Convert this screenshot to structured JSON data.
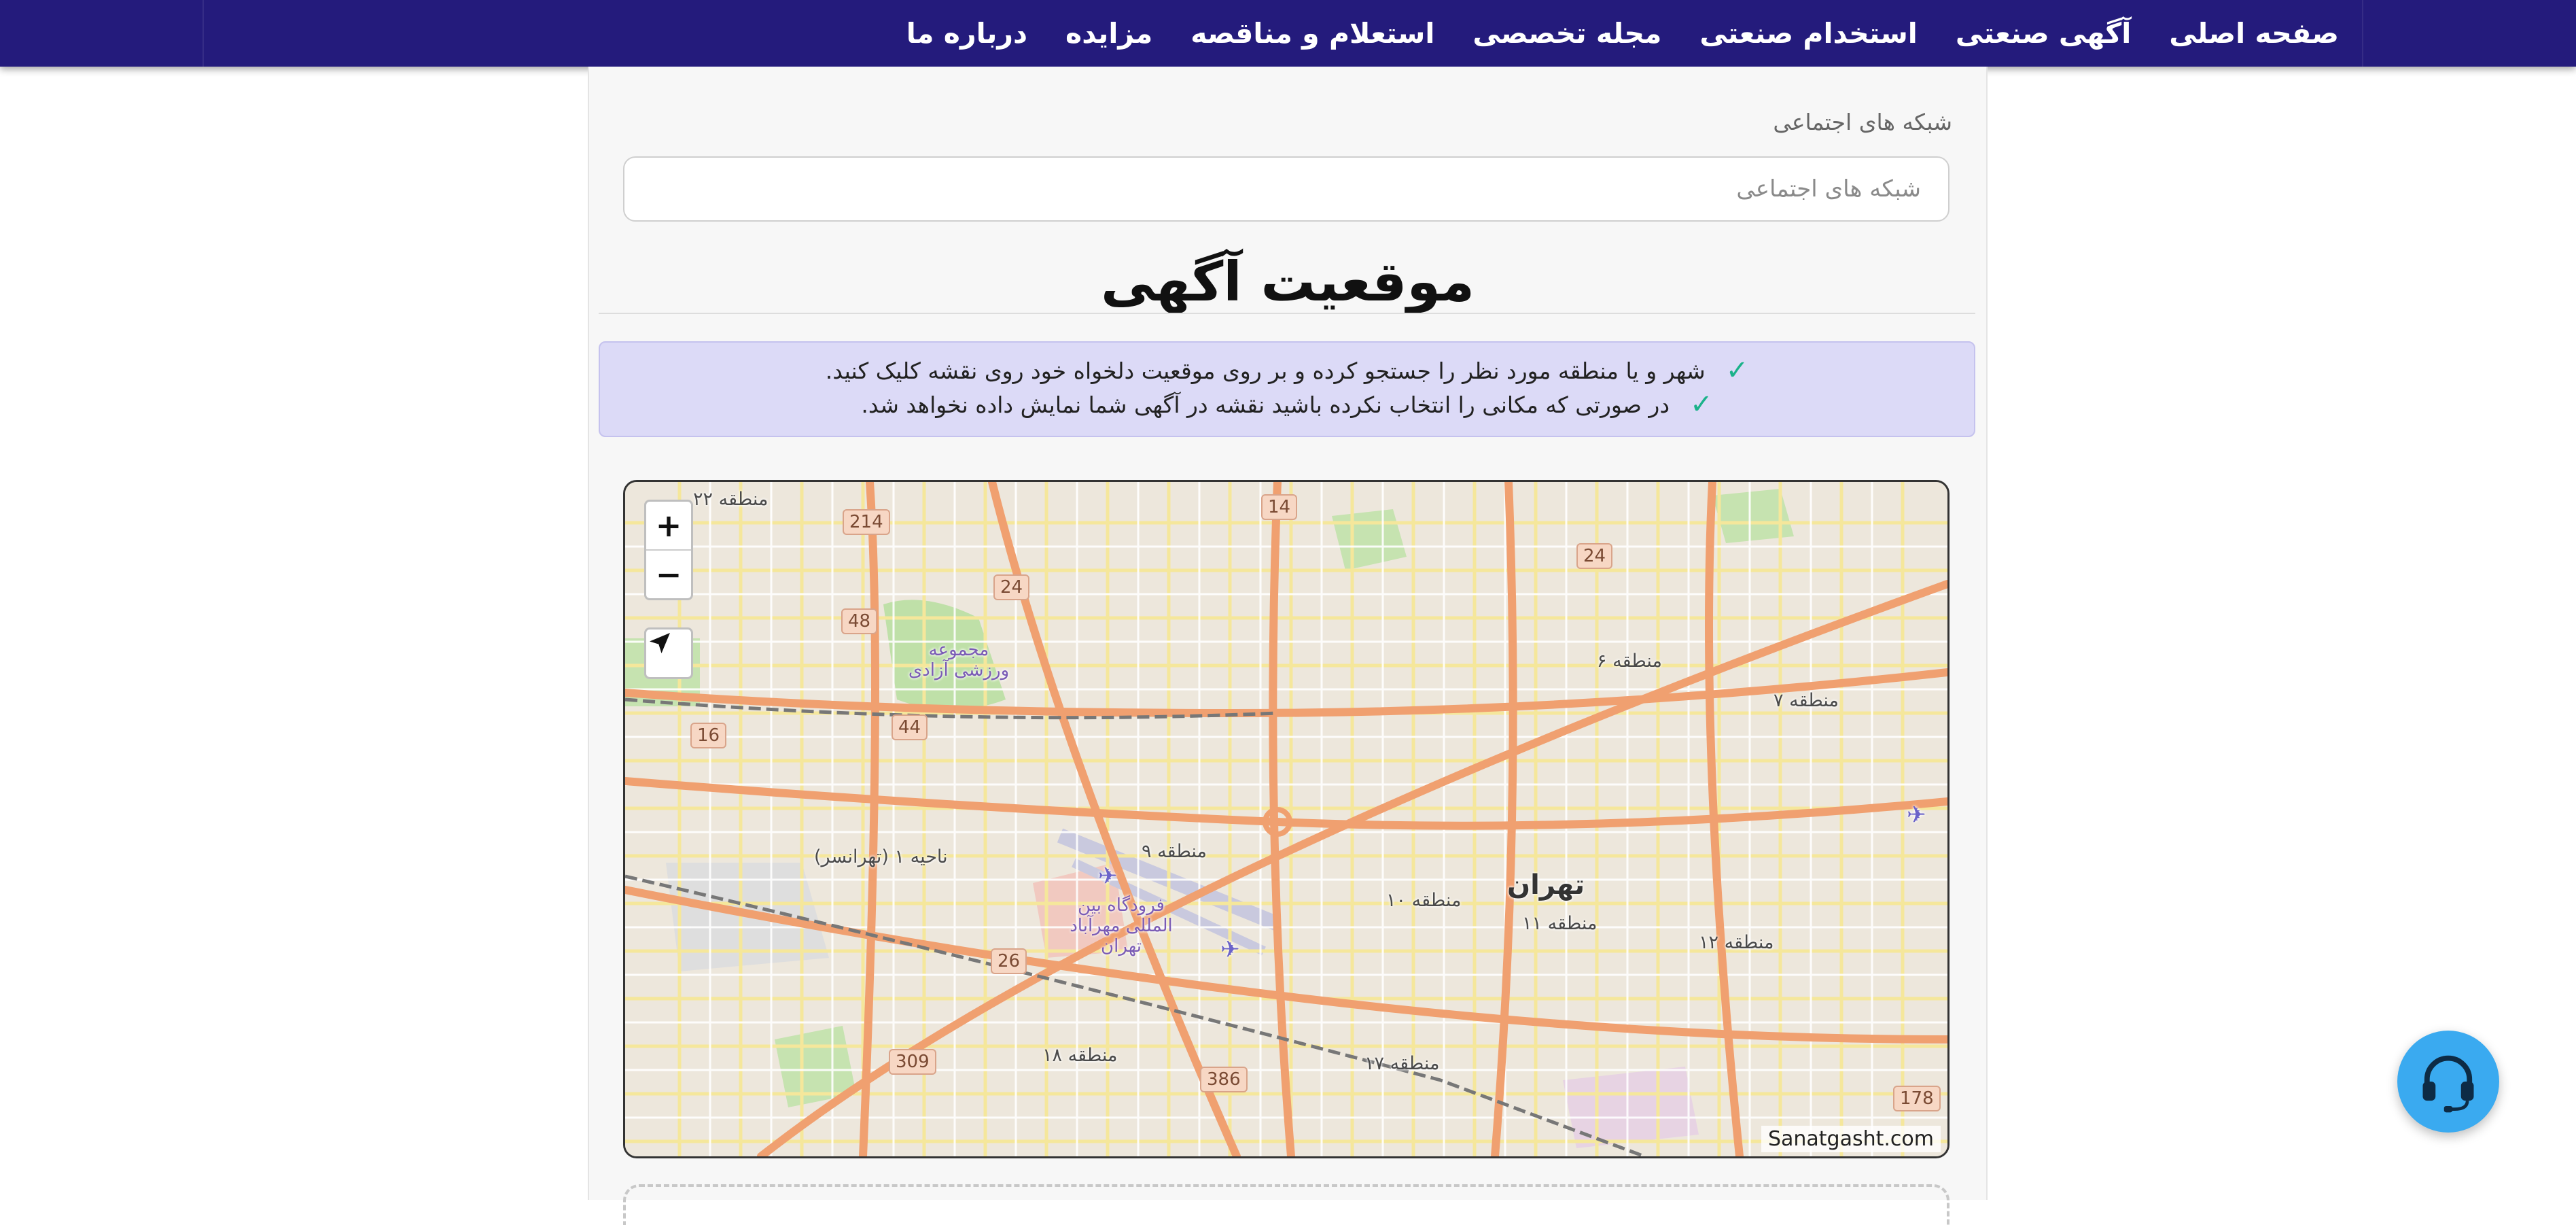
{
  "nav": {
    "items": [
      {
        "label": "صفحه اصلی"
      },
      {
        "label": "آگهی صنعتی"
      },
      {
        "label": "استخدام صنعتی"
      },
      {
        "label": "مجله تخصصی"
      },
      {
        "label": "استعلام و مناقصه"
      },
      {
        "label": "مزایده"
      },
      {
        "label": "درباره ما"
      }
    ]
  },
  "social": {
    "label": "شبکه های اجتماعی",
    "placeholder": "شبکه های اجتماعی"
  },
  "location": {
    "title": "موقعیت آگهی",
    "notices": [
      "شهر و یا منطقه مورد نظر را جستجو کرده و بر روی موقعیت دلخواه خود روی نقشه کلیک کنید.",
      "در صورتی که مکانی را انتخاب نکرده باشید نقشه در آگهی شما نمایش داده نخواهد شد."
    ]
  },
  "map": {
    "zoom_in": "+",
    "zoom_out": "−",
    "attribution": "Sanatgasht.com",
    "city": "تهران",
    "districts": [
      "منطقه ۲۲",
      "منطقه ۶",
      "منطقه ۷",
      "ناحیه ۱ (تهرانسر)",
      "منطقه ۹",
      "منطقه ۱۰",
      "منطقه ۱۱",
      "منطقه ۱۲",
      "منطقه ۱۸",
      "منطقه ۱۷"
    ],
    "pois": [
      "مجموعه ورزشی آزادی",
      "فرودگاه بین المللی مهرآباد تهران"
    ],
    "road_shields": [
      "214",
      "14",
      "24",
      "24",
      "48",
      "44",
      "16",
      "26",
      "309",
      "386",
      "178"
    ]
  },
  "colors": {
    "navbar": "#241b7c",
    "notice_bg": "#dcdaf7",
    "check": "#1bb28a",
    "support": "#3aaaf0"
  }
}
